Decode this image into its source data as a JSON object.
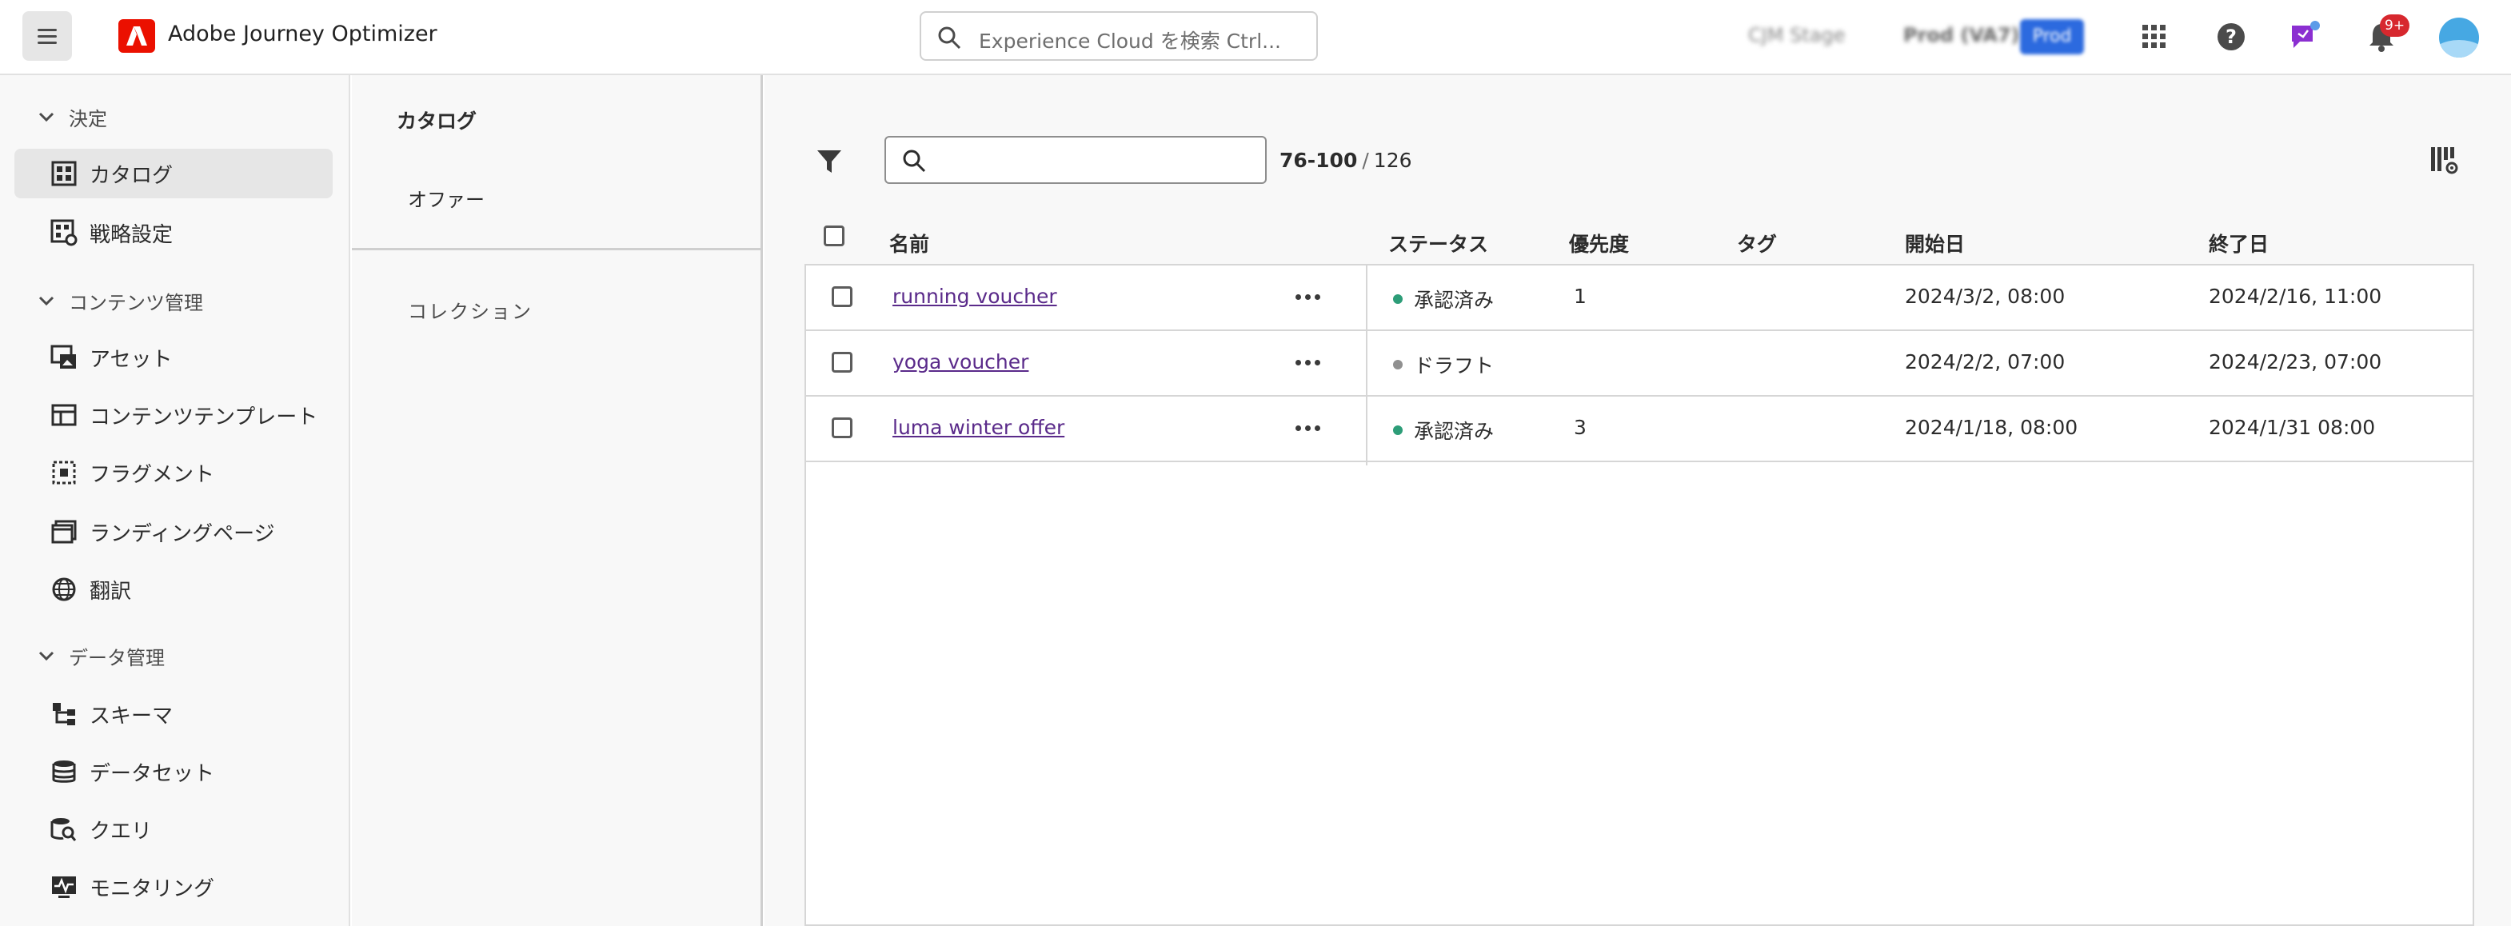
{
  "header": {
    "app_title": "Adobe Journey Optimizer",
    "search_placeholder": "Experience Cloud を検索 Ctrl...",
    "sandbox_label": "CJM Stage",
    "org_label": "Prod (VA7)",
    "env_button": "Prod",
    "notification_count": "9+"
  },
  "sidebar": {
    "sections": [
      {
        "label": "決定",
        "items": [
          {
            "label": "カタログ",
            "icon": "catalog-icon",
            "active": true
          },
          {
            "label": "戦略設定",
            "icon": "strategy-icon",
            "active": false
          }
        ]
      },
      {
        "label": "コンテンツ管理",
        "items": [
          {
            "label": "アセット",
            "icon": "assets-icon"
          },
          {
            "label": "コンテンツテンプレート",
            "icon": "template-icon"
          },
          {
            "label": "フラグメント",
            "icon": "fragment-icon"
          },
          {
            "label": "ランディングページ",
            "icon": "landing-page-icon"
          },
          {
            "label": "翻訳",
            "icon": "globe-icon"
          }
        ]
      },
      {
        "label": "データ管理",
        "items": [
          {
            "label": "スキーマ",
            "icon": "schema-icon"
          },
          {
            "label": "データセット",
            "icon": "database-icon"
          },
          {
            "label": "クエリ",
            "icon": "query-icon"
          },
          {
            "label": "モニタリング",
            "icon": "monitoring-icon"
          }
        ]
      }
    ]
  },
  "catalog": {
    "title": "カタログ",
    "offers": "オファー",
    "collections": "コレクション"
  },
  "toolbar": {
    "range": "76-100",
    "separator": "/",
    "total": "126"
  },
  "table": {
    "columns": {
      "name": "名前",
      "status": "ステータス",
      "priority": "優先度",
      "tags": "タグ",
      "start": "開始日",
      "end": "終了日"
    },
    "rows": [
      {
        "name": "running voucher",
        "status": "承認済み",
        "status_color": "#2d9d78",
        "priority": "1",
        "tags": "",
        "start": "2024/3/2, 08:00",
        "end": "2024/2/16, 11:00"
      },
      {
        "name": "yoga voucher",
        "status": "ドラフト",
        "status_color": "#909090",
        "priority": "",
        "tags": "",
        "start": "2024/2/2, 07:00",
        "end": "2024/2/23, 07:00"
      },
      {
        "name": "luma winter offer",
        "status": "承認済み",
        "status_color": "#2d9d78",
        "priority": "3",
        "tags": "",
        "start": "2024/1/18, 08:00",
        "end": "2024/1/31 08:00"
      }
    ]
  },
  "colors": {
    "brand_red": "#eb1000",
    "approved": "#2d9d78",
    "draft": "#909090",
    "link": "#5a2a8a"
  }
}
